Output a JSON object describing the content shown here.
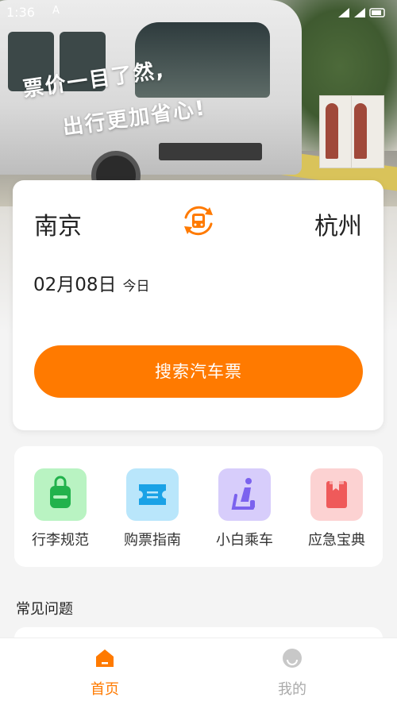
{
  "status_bar": {
    "time": "1:36",
    "notification_glyph": "A"
  },
  "banner": {
    "line1": "票价一目了然,",
    "line2": "出行更加省心!"
  },
  "route": {
    "from_city": "南京",
    "to_city": "杭州",
    "date": "02月08日",
    "date_note": "今日",
    "search_label": "搜索汽车票"
  },
  "shortcuts": [
    {
      "label": "行李规范",
      "icon": "luggage-icon",
      "bg": "#b9f3c2",
      "fg": "#22b24c"
    },
    {
      "label": "购票指南",
      "icon": "ticket-icon",
      "bg": "#b9e6fb",
      "fg": "#1aa2e6"
    },
    {
      "label": "小白乘车",
      "icon": "seat-icon",
      "bg": "#d7cdfb",
      "fg": "#7b62ee"
    },
    {
      "label": "应急宝典",
      "icon": "book-icon",
      "bg": "#fcd2d2",
      "fg": "#ef5a5a"
    }
  ],
  "faq": {
    "title": "常见问题"
  },
  "tabs": [
    {
      "label": "首页",
      "icon": "home-icon",
      "active": true
    },
    {
      "label": "我的",
      "icon": "profile-icon",
      "active": false
    }
  ],
  "colors": {
    "accent": "#ff7a00",
    "inactive": "#aaaaaa"
  }
}
